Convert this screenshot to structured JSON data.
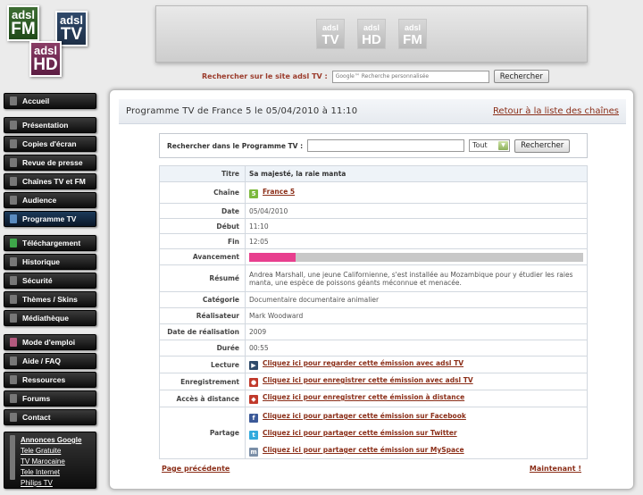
{
  "logos": {
    "fm": [
      "adsl",
      "FM"
    ],
    "tv": [
      "adsl",
      "TV"
    ],
    "hd": [
      "adsl",
      "HD"
    ]
  },
  "banner": {
    "icons": [
      [
        "adsl",
        "TV"
      ],
      [
        "adsl",
        "HD"
      ],
      [
        "adsl",
        "FM"
      ]
    ]
  },
  "site_search": {
    "label": "Rechercher sur le site adsl TV :",
    "placeholder": "Google™ Recherche personnalisée",
    "button": "Rechercher"
  },
  "sidebar": {
    "items": [
      "Accueil",
      "Présentation",
      "Copies d'écran",
      "Revue de presse",
      "Chaînes TV et FM",
      "Audience",
      "Programme TV",
      "Téléchargement",
      "Historique",
      "Sécurité",
      "Thèmes / Skins",
      "Médiathèque",
      "Mode d'emploi",
      "Aide / FAQ",
      "Ressources",
      "Forums",
      "Contact"
    ],
    "ads": {
      "title": "Annonces Google",
      "links": [
        "Tele Gratuite",
        "TV Marocaine",
        "Tele Internet",
        "Philips TV"
      ]
    }
  },
  "main": {
    "title": "Programme TV de France 5 le 05/04/2010 à 11:10",
    "back_link": "Retour à la liste des chaînes",
    "search": {
      "label": "Rechercher dans le Programme TV :",
      "select_value": "Tout",
      "button": "Rechercher"
    },
    "rows": {
      "titre": {
        "k": "Titre",
        "v": "Sa majesté, la raie manta"
      },
      "chaine": {
        "k": "Chaîne",
        "v": "France 5",
        "icon_text": "5"
      },
      "date": {
        "k": "Date",
        "v": "05/04/2010"
      },
      "debut": {
        "k": "Début",
        "v": "11:10"
      },
      "fin": {
        "k": "Fin",
        "v": "12:05"
      },
      "avancement": {
        "k": "Avancement",
        "progress_fraction": 0.14
      },
      "resume": {
        "k": "Résumé",
        "v": "Andrea Marshall, une jeune Californienne, s'est installée au Mozambique pour y étudier les raies manta, une espèce de poissons géants méconnue et menacée."
      },
      "categorie": {
        "k": "Catégorie",
        "v": "Documentaire documentaire animalier"
      },
      "realisateur": {
        "k": "Réalisateur",
        "v": "Mark Woodward"
      },
      "date_realisation": {
        "k": "Date de réalisation",
        "v": "2009"
      },
      "duree": {
        "k": "Durée",
        "v": "00:55"
      },
      "lecture": {
        "k": "Lecture",
        "v": "Cliquez ici pour regarder cette émission avec adsl TV"
      },
      "enregistrement": {
        "k": "Enregistrement",
        "v": "Cliquez ici pour enregistrer cette émission avec adsl TV"
      },
      "acces": {
        "k": "Accès à distance",
        "v": "Cliquez ici pour enregistrer cette émission à distance"
      },
      "partage": {
        "k": "Partage",
        "facebook": "Cliquez ici pour partager cette émission sur Facebook",
        "twitter": "Cliquez ici pour partager cette émission sur Twitter",
        "myspace": "Cliquez ici pour partager cette émission sur MySpace"
      }
    },
    "prev": "Page précédente",
    "now": "Maintenant !"
  },
  "colors": {
    "accent_link": "#8b2e18",
    "progress_fill": "#e83f8e",
    "nav_bg": "#1a1a1a"
  }
}
